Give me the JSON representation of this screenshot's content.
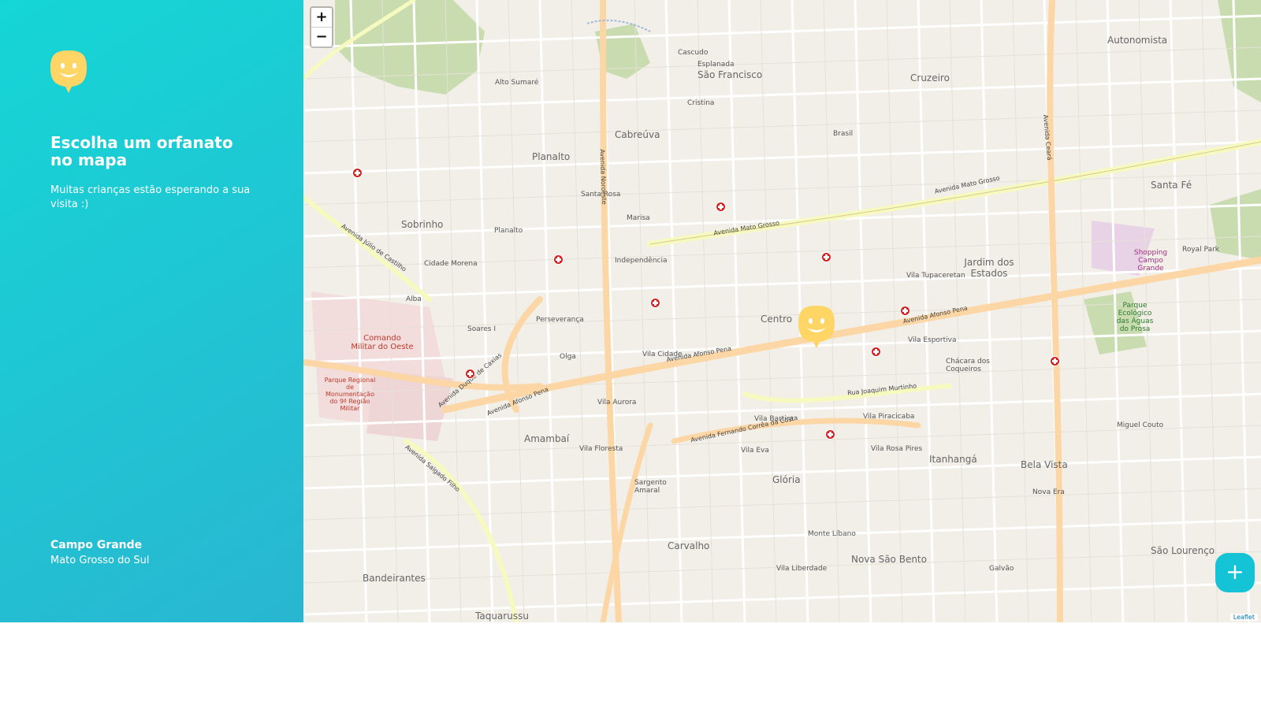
{
  "sidebar": {
    "title": "Escolha um orfanato no mapa",
    "subtitle": "Muitas crianças estão esperando a sua visita :)",
    "city": "Campo Grande",
    "state": "Mato Grosso do Sul",
    "logo_icon": "happy-face-marker-icon"
  },
  "map": {
    "zoom_in": "+",
    "zoom_out": "−",
    "add_button": "+",
    "attribution": "Leaflet",
    "labels": {
      "sao_francisco": "São Francisco",
      "cruzeiro": "Cruzeiro",
      "autonomista": "Autonomista",
      "planalto": "Planalto",
      "cabreuva": "Cabreúva",
      "sobrinho": "Sobrinho",
      "centro": "Centro",
      "jardim_dos_estados": "Jardim dos Estados",
      "amambai": "Amambaí",
      "bela_vista": "Bela Vista",
      "gloria": "Glória",
      "carvalho": "Carvalho",
      "nova_sao_bento": "Nova São Bento",
      "bandeirantes": "Bandeirantes",
      "itanhanga": "Itanhangá",
      "santa_fe": "Santa Fé",
      "sao_lourenco": "São Lourenço",
      "taquarussu": "Taquarussu",
      "comando_militar": "Comando Militar do Oeste",
      "parque_regional": "Parque Regional de Monumentação do 9ª Região Militar",
      "avenida_mato_grosso": "Avenida Mato Grosso",
      "avenida_afonso_pena": "Avenida Afonso Pena",
      "avenida_fernando": "Avenida Fernando Corrêa da Costa",
      "avenida_duque": "Avenida Duque de Caxias",
      "avenida_julio": "Avenida Júlio de Castilho",
      "avenida_noroeste": "Avenida Noroeste",
      "avenida_ceara": "Avenida Ceará",
      "rua_joaquim": "Rua Joaquim Murtinho",
      "avenida_salgado": "Avenida Salgado Filho",
      "esplanada": "Esplanada",
      "vila_cidade": "Vila Cidade",
      "santa_rosa": "Santa Rosa",
      "marisa": "Marisa",
      "vila_planalto": "Planalto",
      "vila_alba": "Alba",
      "cidade_morena": "Cidade Morena",
      "soares_i": "Soares I",
      "chacara_coqueiros": "Chácara dos Coqueiros",
      "vila_esportiva": "Vila Esportiva",
      "vila_tupaceretan": "Vila Tupaceretan",
      "rosa_pires": "Vila Rosa Pires",
      "monte_libano": "Monte Líbano",
      "vila_liberdade": "Vila Liberdade",
      "galvao": "Galvão",
      "shopping": "Shopping Campo Grande",
      "parque_ecologico": "Parque Ecológico das Águas do Prosa",
      "royal_park": "Royal Park",
      "miguel_couto": "Miguel Couto",
      "nova_era": "Nova Era",
      "vila_piracicaba": "Vila Piracicaba",
      "alto_sumare": "Alto Sumaré",
      "cascudo": "Cascudo",
      "cristina": "Cristina",
      "brasil": "Brasil",
      "independencia": "Independência",
      "perseveranca": "Perseverança",
      "olga": "Olga",
      "vila_aurora": "Vila Aurora",
      "vila_floresta": "Vila Floresta",
      "sargento_amaral": "Sargento Amaral",
      "vila_eva": "Vila Eva",
      "vila_bartira": "Vila Bartira"
    }
  }
}
